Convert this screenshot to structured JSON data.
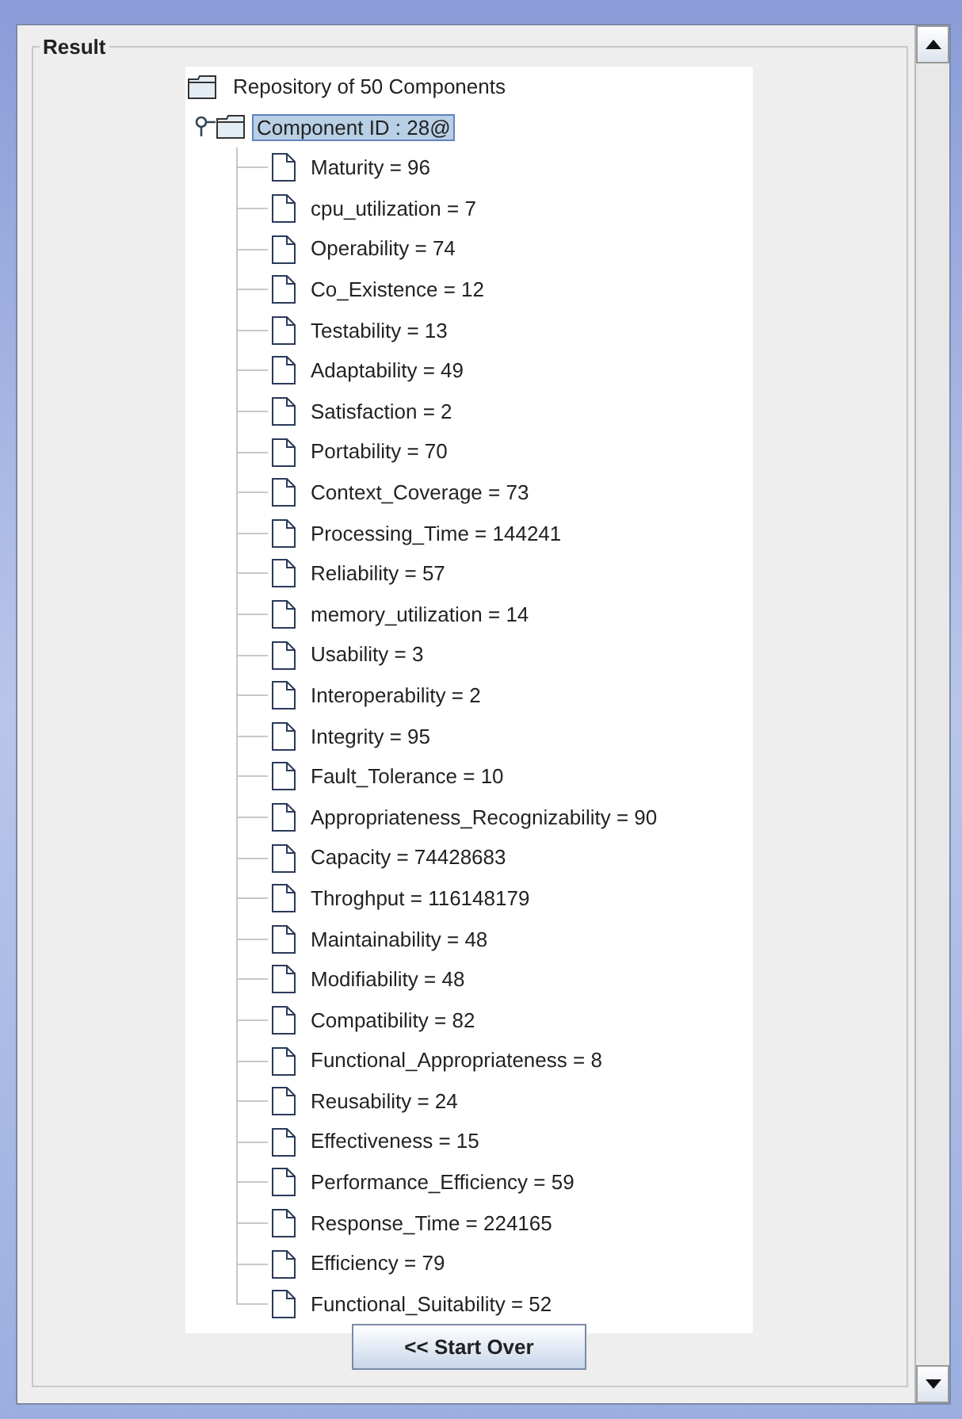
{
  "panel": {
    "title": "Result"
  },
  "tree": {
    "label": "Repository of 50 Components",
    "kind": "folder",
    "children": [
      {
        "label": "Component ID : 28@",
        "kind": "folder",
        "selected": true,
        "expanded": true,
        "children": [
          {
            "label": "Maturity = 96",
            "kind": "file"
          },
          {
            "label": "cpu_utilization = 7",
            "kind": "file"
          },
          {
            "label": "Operability = 74",
            "kind": "file"
          },
          {
            "label": "Co_Existence = 12",
            "kind": "file"
          },
          {
            "label": "Testability = 13",
            "kind": "file"
          },
          {
            "label": "Adaptability = 49",
            "kind": "file"
          },
          {
            "label": "Satisfaction = 2",
            "kind": "file"
          },
          {
            "label": "Portability = 70",
            "kind": "file"
          },
          {
            "label": "Context_Coverage = 73",
            "kind": "file"
          },
          {
            "label": "Processing_Time = 144241",
            "kind": "file"
          },
          {
            "label": "Reliability = 57",
            "kind": "file"
          },
          {
            "label": "memory_utilization = 14",
            "kind": "file"
          },
          {
            "label": "Usability = 3",
            "kind": "file"
          },
          {
            "label": "Interoperability = 2",
            "kind": "file"
          },
          {
            "label": "Integrity = 95",
            "kind": "file"
          },
          {
            "label": "Fault_Tolerance = 10",
            "kind": "file"
          },
          {
            "label": "Appropriateness_Recognizability = 90",
            "kind": "file"
          },
          {
            "label": "Capacity = 74428683",
            "kind": "file"
          },
          {
            "label": "Throghput = 116148179",
            "kind": "file"
          },
          {
            "label": "Maintainability = 48",
            "kind": "file"
          },
          {
            "label": "Modifiability = 48",
            "kind": "file"
          },
          {
            "label": "Compatibility = 82",
            "kind": "file"
          },
          {
            "label": "Functional_Appropriateness = 8",
            "kind": "file"
          },
          {
            "label": "Reusability = 24",
            "kind": "file"
          },
          {
            "label": "Effectiveness = 15",
            "kind": "file"
          },
          {
            "label": "Performance_Efficiency = 59",
            "kind": "file"
          },
          {
            "label": "Response_Time = 224165",
            "kind": "file"
          },
          {
            "label": "Efficiency = 79",
            "kind": "file"
          },
          {
            "label": "Functional_Suitability = 52",
            "kind": "file"
          }
        ]
      }
    ]
  },
  "button": {
    "label": "<< Start Over"
  }
}
